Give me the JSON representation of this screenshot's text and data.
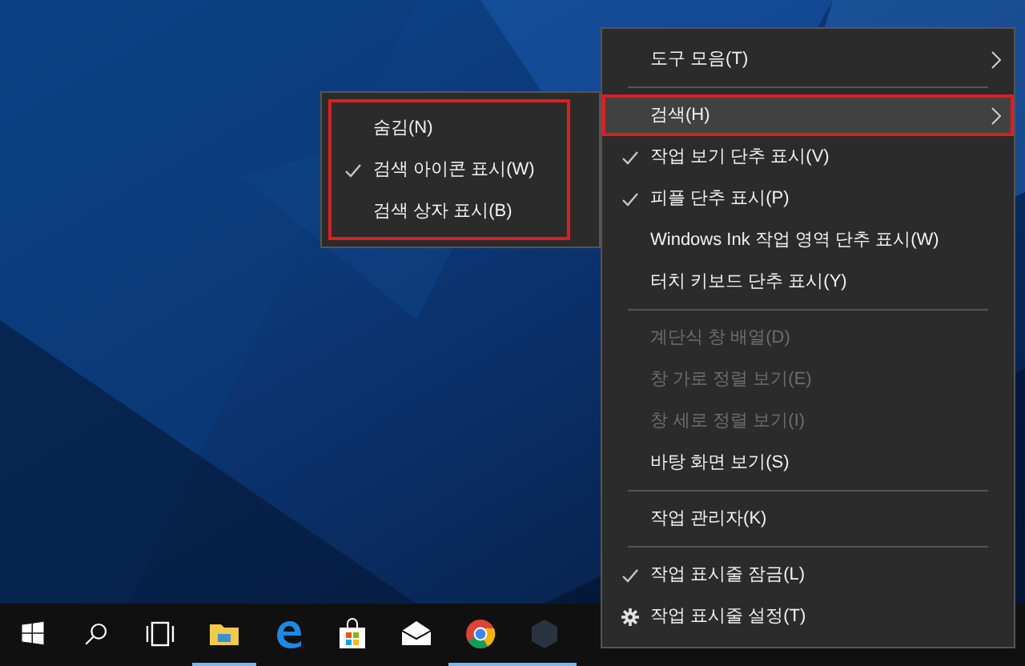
{
  "menu": {
    "items": [
      {
        "kind": "item",
        "label": "도구 모음(T)",
        "checked": false,
        "disabled": false,
        "submenu": true,
        "selected": false
      },
      {
        "kind": "separator"
      },
      {
        "kind": "item",
        "label": "검색(H)",
        "checked": false,
        "disabled": false,
        "submenu": true,
        "selected": true
      },
      {
        "kind": "item",
        "label": "작업 보기 단추 표시(V)",
        "checked": true,
        "disabled": false,
        "submenu": false,
        "selected": false
      },
      {
        "kind": "item",
        "label": "피플 단추 표시(P)",
        "checked": true,
        "disabled": false,
        "submenu": false,
        "selected": false
      },
      {
        "kind": "item",
        "label": "Windows Ink 작업 영역 단추 표시(W)",
        "checked": false,
        "disabled": false,
        "submenu": false,
        "selected": false
      },
      {
        "kind": "item",
        "label": "터치 키보드 단추 표시(Y)",
        "checked": false,
        "disabled": false,
        "submenu": false,
        "selected": false
      },
      {
        "kind": "separator"
      },
      {
        "kind": "item",
        "label": "계단식 창 배열(D)",
        "checked": false,
        "disabled": true,
        "submenu": false,
        "selected": false
      },
      {
        "kind": "item",
        "label": "창 가로 정렬 보기(E)",
        "checked": false,
        "disabled": true,
        "submenu": false,
        "selected": false
      },
      {
        "kind": "item",
        "label": "창 세로 정렬 보기(I)",
        "checked": false,
        "disabled": true,
        "submenu": false,
        "selected": false
      },
      {
        "kind": "item",
        "label": "바탕 화면 보기(S)",
        "checked": false,
        "disabled": false,
        "submenu": false,
        "selected": false
      },
      {
        "kind": "separator"
      },
      {
        "kind": "item",
        "label": "작업 관리자(K)",
        "checked": false,
        "disabled": false,
        "submenu": false,
        "selected": false
      },
      {
        "kind": "separator"
      },
      {
        "kind": "item",
        "label": "작업 표시줄 잠금(L)",
        "checked": true,
        "disabled": false,
        "submenu": false,
        "selected": false
      },
      {
        "kind": "gear-item",
        "label": "작업 표시줄 설정(T)",
        "disabled": false,
        "submenu": false,
        "selected": false
      }
    ]
  },
  "submenu": {
    "highlighted": true,
    "items": [
      {
        "label": "숨김(N)",
        "checked": false
      },
      {
        "label": "검색 아이콘 표시(W)",
        "checked": true
      },
      {
        "label": "검색 상자 표시(B)",
        "checked": false
      }
    ]
  },
  "taskbar": {
    "icons": [
      {
        "kind": "start",
        "running": false
      },
      {
        "kind": "search",
        "running": false
      },
      {
        "kind": "taskview",
        "running": false
      },
      {
        "kind": "folder",
        "running": true
      },
      {
        "kind": "edge",
        "running": false
      },
      {
        "kind": "store",
        "running": false
      },
      {
        "kind": "mail",
        "running": false
      },
      {
        "kind": "chrome",
        "running": true
      },
      {
        "kind": "nox",
        "running": true
      }
    ]
  }
}
